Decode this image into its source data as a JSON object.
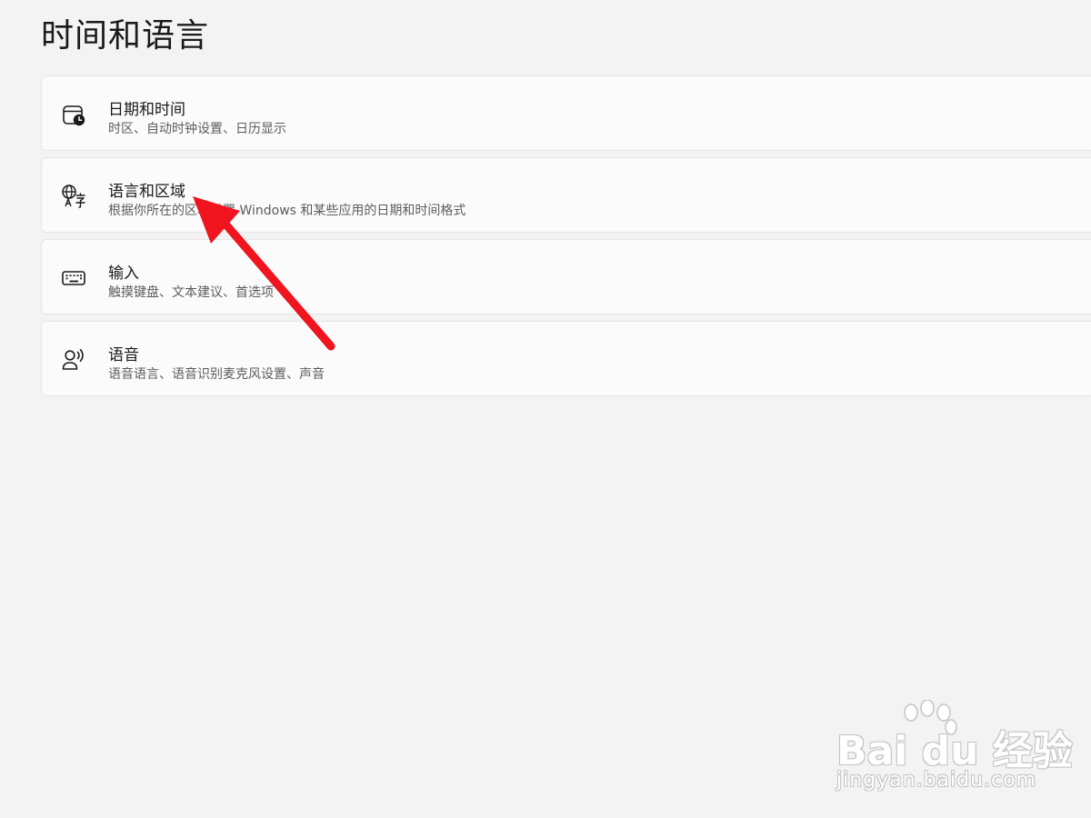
{
  "page": {
    "title": "时间和语言"
  },
  "settings": [
    {
      "icon": "calendar-clock-icon",
      "title": "日期和时间",
      "description": "时区、自动时钟设置、日历显示"
    },
    {
      "icon": "language-translate-icon",
      "title": "语言和区域",
      "description": "根据你所在的区域设置 Windows 和某些应用的日期和时间格式"
    },
    {
      "icon": "keyboard-icon",
      "title": "输入",
      "description": "触摸键盘、文本建议、首选项"
    },
    {
      "icon": "speech-person-icon",
      "title": "语音",
      "description": "语音语言、语音识别麦克风设置、声音"
    }
  ],
  "annotation": {
    "arrow_color": "#f0141e",
    "points_to": "语言和区域"
  },
  "watermark": {
    "logo_text": "Bai du 经验",
    "url_text": "jingyan.baidu.com"
  }
}
